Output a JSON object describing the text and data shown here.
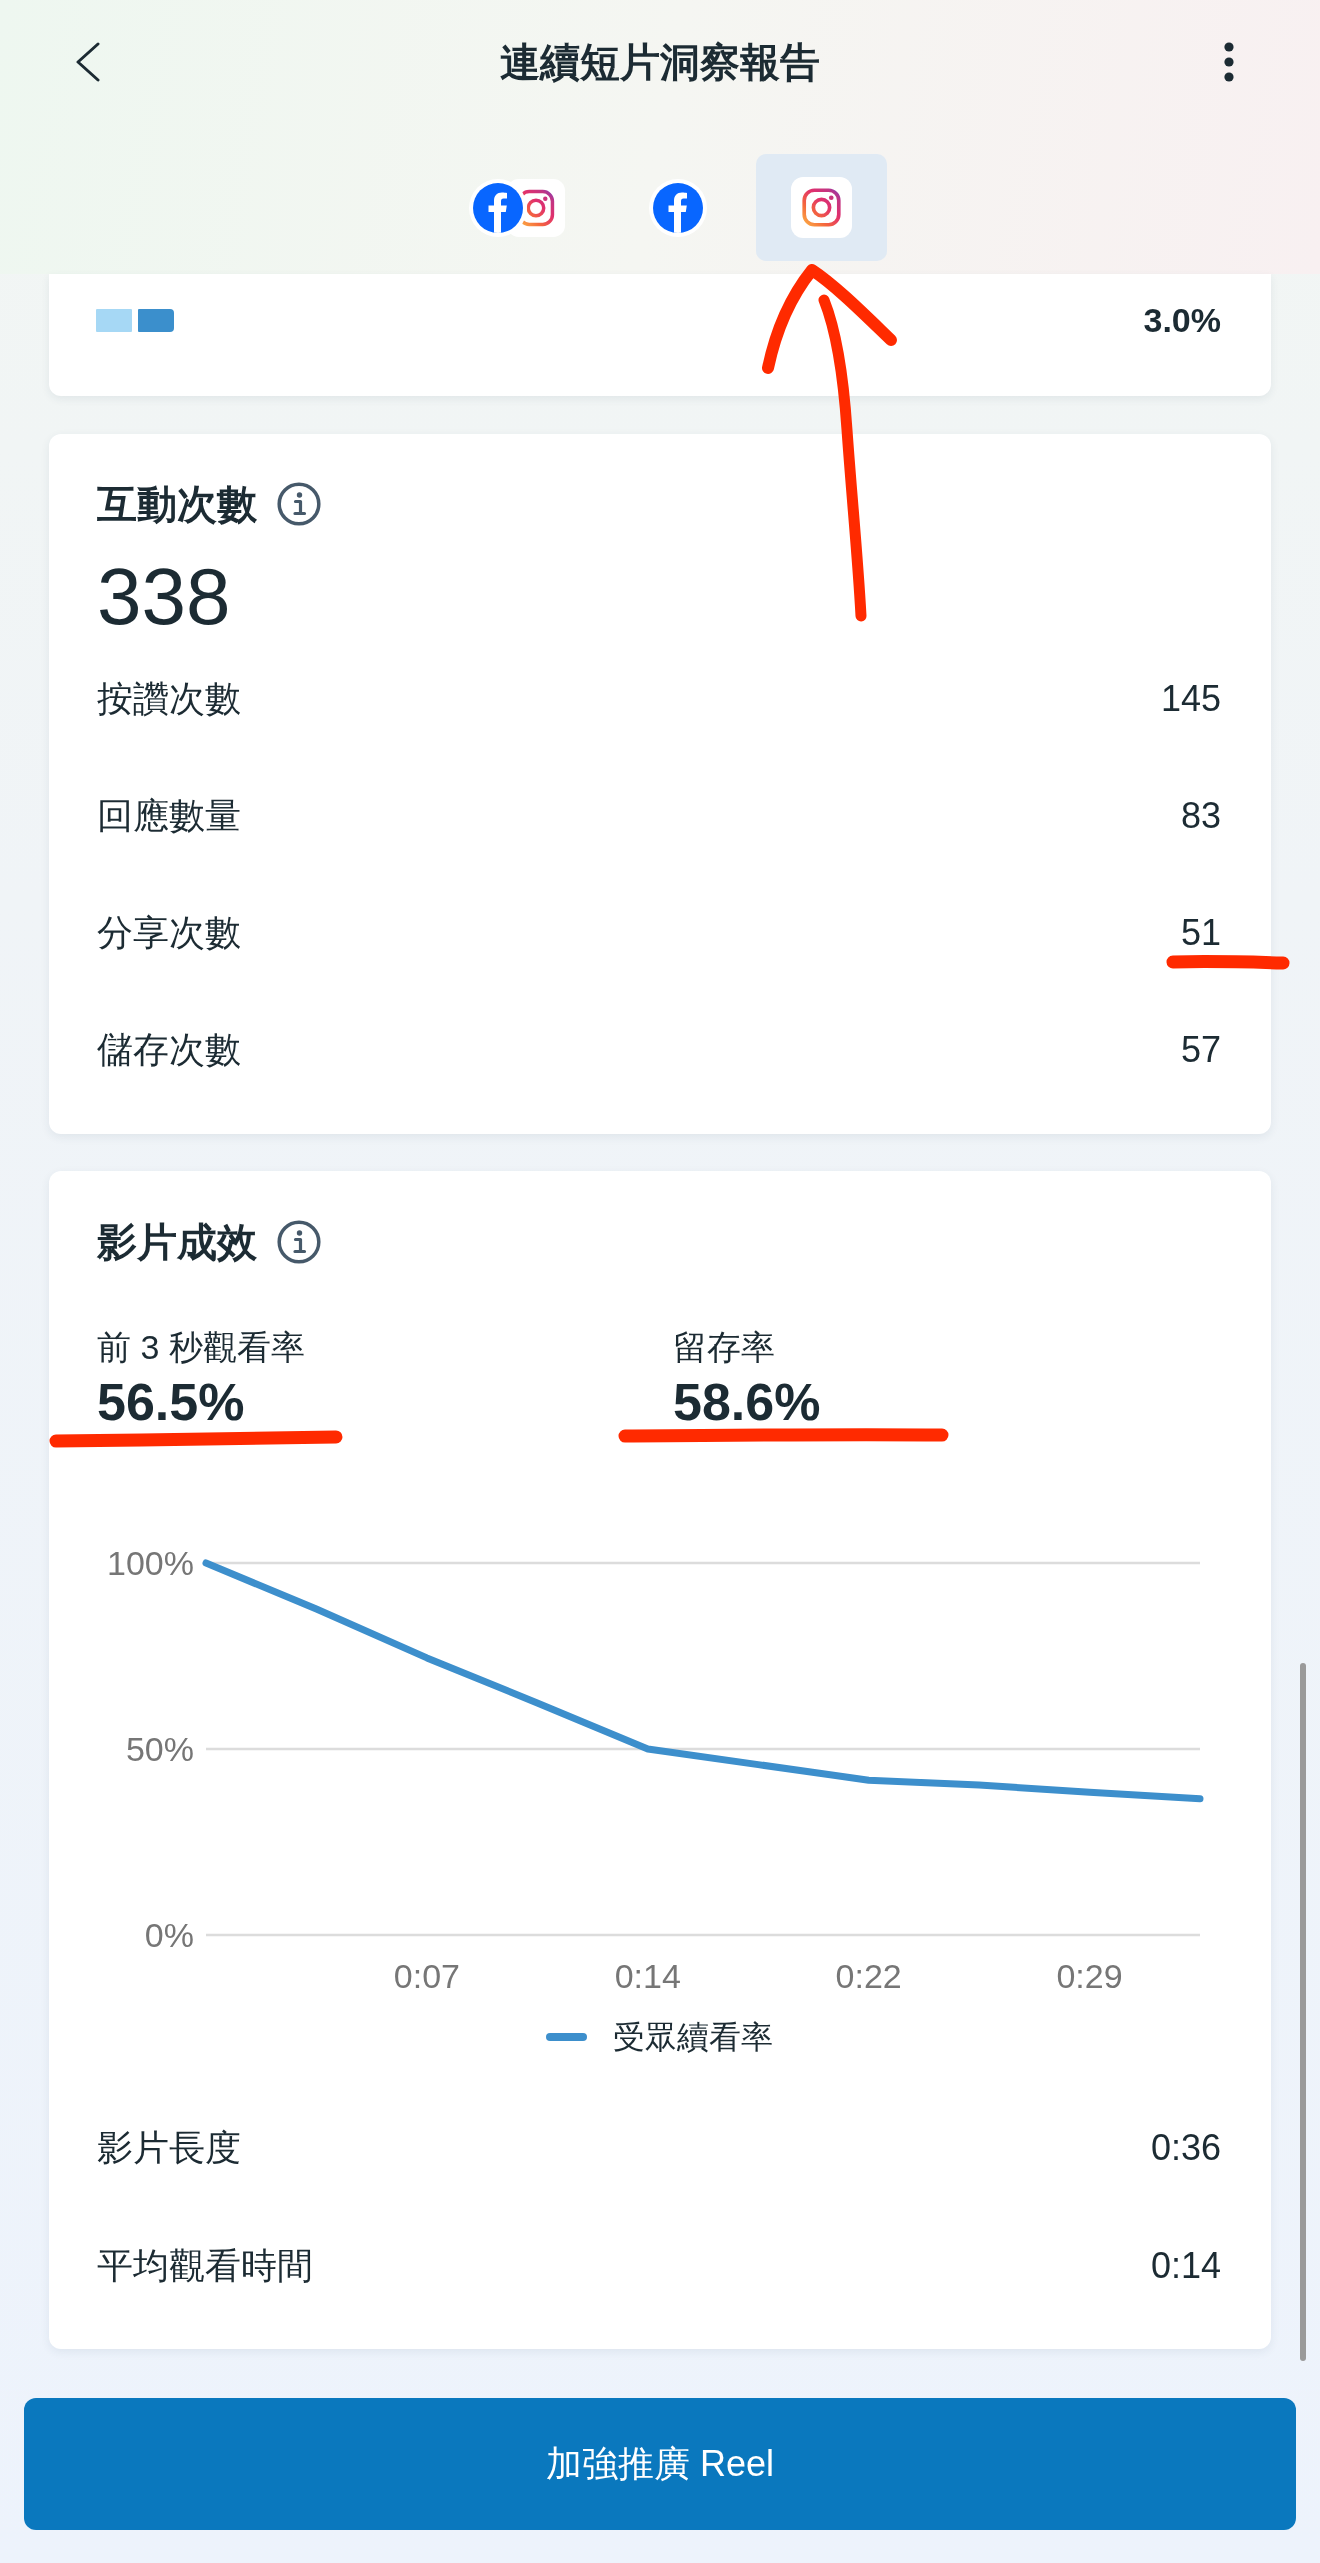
{
  "header": {
    "title": "連續短片洞察報告"
  },
  "tabs": [
    {
      "kind": "facebook_instagram",
      "selected": false
    },
    {
      "kind": "facebook",
      "selected": false
    },
    {
      "kind": "instagram",
      "selected": true
    }
  ],
  "partial_card": {
    "swatches": [
      {
        "color": "#a6d8f5"
      },
      {
        "color": "#3b8fcc"
      }
    ],
    "value": "3.0%"
  },
  "interactions": {
    "title": "互動次數",
    "total": "338",
    "rows": [
      {
        "label": "按讚次數",
        "value": "145"
      },
      {
        "label": "回應數量",
        "value": "83"
      },
      {
        "label": "分享次數",
        "value": "51"
      },
      {
        "label": "儲存次數",
        "value": "57"
      }
    ]
  },
  "video_performance": {
    "title": "影片成效",
    "metrics": [
      {
        "label": "前 3 秒觀看率",
        "value": "56.5%"
      },
      {
        "label": "留存率",
        "value": "58.6%"
      }
    ],
    "chart_data": {
      "type": "line",
      "x": [
        0,
        3.6,
        7.2,
        10.8,
        14.4,
        18,
        21.6,
        25.2,
        28.8,
        32.4
      ],
      "series": [
        {
          "name": "受眾續看率",
          "color": "#3d8fcc",
          "values": [
            100,
            87.6,
            74.5,
            62.4,
            50,
            45.8,
            41.6,
            40.3,
            38.4,
            36.6
          ]
        }
      ],
      "xlim": [
        0,
        32.4
      ],
      "ylim": [
        0,
        100
      ],
      "xticks": [
        {
          "value": 7.2,
          "label": "0:07"
        },
        {
          "value": 14.4,
          "label": "0:14"
        },
        {
          "value": 21.6,
          "label": "0:22"
        },
        {
          "value": 28.8,
          "label": "0:29"
        }
      ],
      "yticks": [
        {
          "value": 0,
          "label": "0%"
        },
        {
          "value": 50,
          "label": "50%"
        },
        {
          "value": 100,
          "label": "100%"
        }
      ]
    },
    "rows": [
      {
        "label": "影片長度",
        "value": "0:36"
      },
      {
        "label": "平均觀看時間",
        "value": "0:14"
      }
    ]
  },
  "boost_button": {
    "label": "加強推廣 Reel"
  }
}
